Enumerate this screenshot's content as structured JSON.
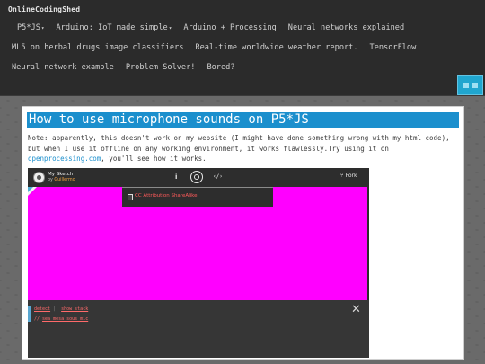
{
  "nav": {
    "brand": "OnlineCodingShed",
    "row1": [
      {
        "label": "P5*JS",
        "dropdown": true
      },
      {
        "label": "Arduino: IoT made simple",
        "dropdown": true
      },
      {
        "label": "Arduino + Processing",
        "dropdown": false
      },
      {
        "label": "Neural networks explained",
        "dropdown": false
      }
    ],
    "row2": [
      {
        "label": "ML5 on herbal drugs image classifiers"
      },
      {
        "label": "Real-time worldwide weather report."
      },
      {
        "label": "TensorFlow"
      }
    ],
    "row3": [
      {
        "label": "Neural network example"
      },
      {
        "label": "Problem Solver!"
      },
      {
        "label": "Bored?"
      }
    ],
    "caret": "▾",
    "menu_button_icon": "grid-icon",
    "accent_color": "#20a6cf"
  },
  "post": {
    "title": "How to use microphone sounds on P5*JS",
    "note_before_link": "Note: apparently, this doesn't work on my website (I might have done something wrong with my html code), but when I use it offline on any working environment, it works flawlessly.Try using it on ",
    "note_link": "openprocessing.com",
    "note_after_link": ", you'll see how it works.",
    "title_bg_color": "#1b8fcd"
  },
  "sketch": {
    "name": "My Sketch",
    "by_prefix": "by ",
    "author": "Guillermo",
    "info_icon_glyph": "i",
    "code_icon_glyph": "‹/›",
    "fork_label": "Fork",
    "fork_icon_glyph": "⑂",
    "license_text": "CC Attribution ShareAlike",
    "canvas_color": "#ff00ff",
    "console": {
      "line1_a": "detect",
      "line1_sep": " || ",
      "line1_b": "show stack",
      "line2_prefix": "// ",
      "line2_link": "sea_mesa_sous_mic"
    },
    "close_glyph": "✕"
  }
}
